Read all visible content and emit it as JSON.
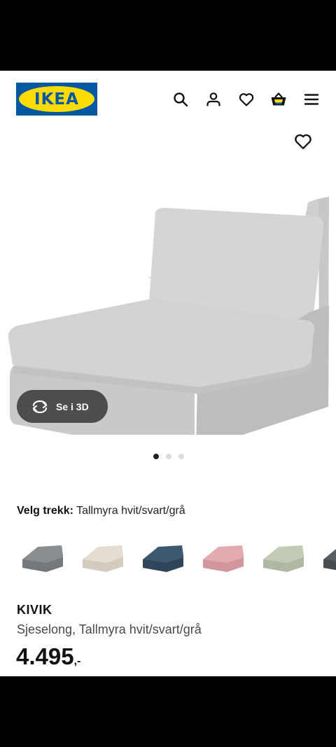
{
  "brand": {
    "logo_text": "IKEA",
    "blue": "#0058a3",
    "yellow": "#ffdb00"
  },
  "header": {
    "icons": [
      "search-icon",
      "user-icon",
      "heart-icon",
      "basket-icon",
      "menu-icon"
    ]
  },
  "hero": {
    "image_alt_icon": "chaise-longue-image",
    "view_3d_label": "Se i 3D",
    "carousel": {
      "count": 3,
      "active_index": 0
    }
  },
  "variant": {
    "label": "Velg trekk:",
    "value": "Tallmyra hvit/svart/grå",
    "swatches": [
      {
        "name": "grey",
        "color": "#8a8d8f"
      },
      {
        "name": "beige",
        "color": "#e5ddd2"
      },
      {
        "name": "blue",
        "color": "#3e5870"
      },
      {
        "name": "pink",
        "color": "#e3aab0"
      },
      {
        "name": "light-green",
        "color": "#c2ccb4"
      },
      {
        "name": "dark-grey",
        "color": "#5a5e63"
      }
    ]
  },
  "product": {
    "name": "KIVIK",
    "description": "Sjeselong, Tallmyra hvit/svart/grå",
    "price": "4.495",
    "price_suffix": ",-"
  }
}
